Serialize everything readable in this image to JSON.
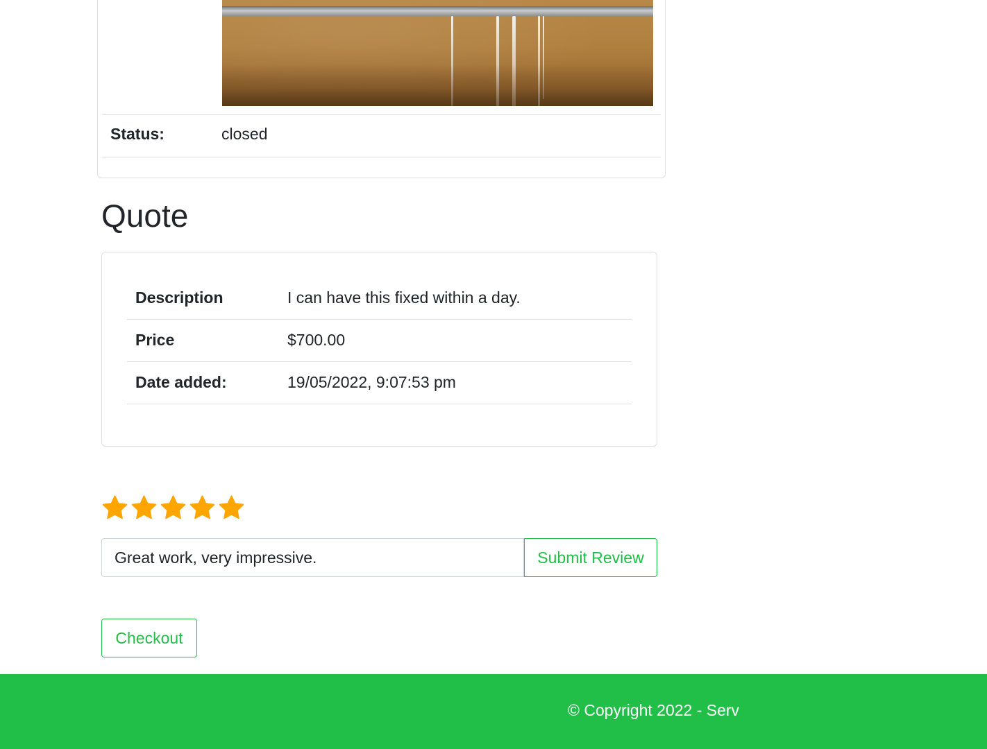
{
  "job": {
    "status_label": "Status:",
    "status_value": "closed"
  },
  "quote": {
    "heading": "Quote",
    "rows": [
      {
        "key": "Description",
        "value": "I can have this fixed within a day."
      },
      {
        "key": "Price",
        "value": "$700.00"
      },
      {
        "key": "Date added:",
        "value": "19/05/2022, 9:07:53 pm"
      }
    ]
  },
  "review": {
    "rating": 5,
    "max_rating": 5,
    "star_color": "#ffa500",
    "text": "Great work, very impressive.",
    "submit_label": "Submit Review"
  },
  "checkout": {
    "label": "Checkout"
  },
  "footer": {
    "copyright": "© Copyright 2022 - Serv",
    "background": "#21bf47"
  },
  "colors": {
    "accent": "#21bf47",
    "text": "#212529",
    "border": "#dfdfdf"
  }
}
